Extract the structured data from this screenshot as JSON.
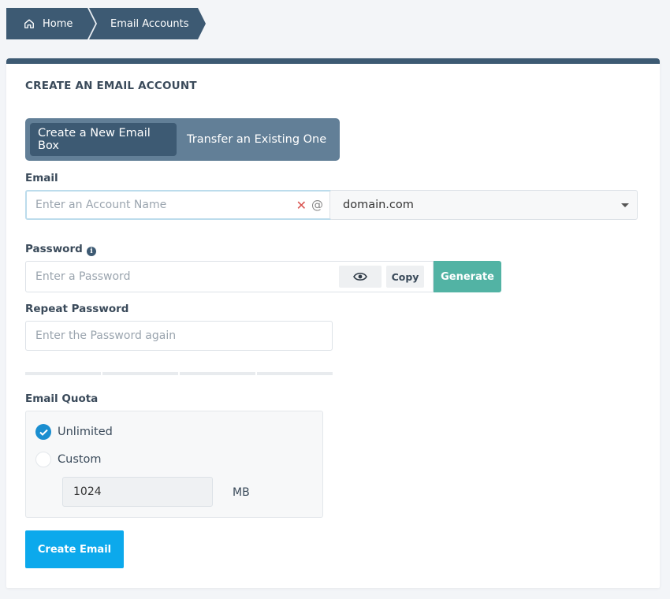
{
  "breadcrumb": {
    "home": "Home",
    "current": "Email Accounts"
  },
  "panel": {
    "title": "CREATE AN EMAIL ACCOUNT"
  },
  "tabs": {
    "active": "Create a New Email Box",
    "inactive": "Transfer an Existing One"
  },
  "email": {
    "label": "Email",
    "placeholder": "Enter an Account Name",
    "clear_icon": "close-icon",
    "at": "@",
    "domain": "domain.com"
  },
  "password": {
    "label": "Password",
    "info": "i",
    "placeholder": "Enter a Password",
    "copy_label": "Copy",
    "generate_label": "Generate"
  },
  "repeat_password": {
    "label": "Repeat Password",
    "placeholder": "Enter the Password again"
  },
  "strength_meter": {
    "segments": 4,
    "filled": 0
  },
  "quota": {
    "label": "Email Quota",
    "unlimited_label": "Unlimited",
    "custom_label": "Custom",
    "value": "1024",
    "unit": "MB",
    "selected": "unlimited"
  },
  "submit": {
    "label": "Create Email"
  },
  "colors": {
    "primary_dark": "#3d5a73",
    "tab_bg": "#627f97",
    "generate": "#52b3a4",
    "create": "#0ca9ec",
    "radio_checked": "#1a8ed0"
  }
}
